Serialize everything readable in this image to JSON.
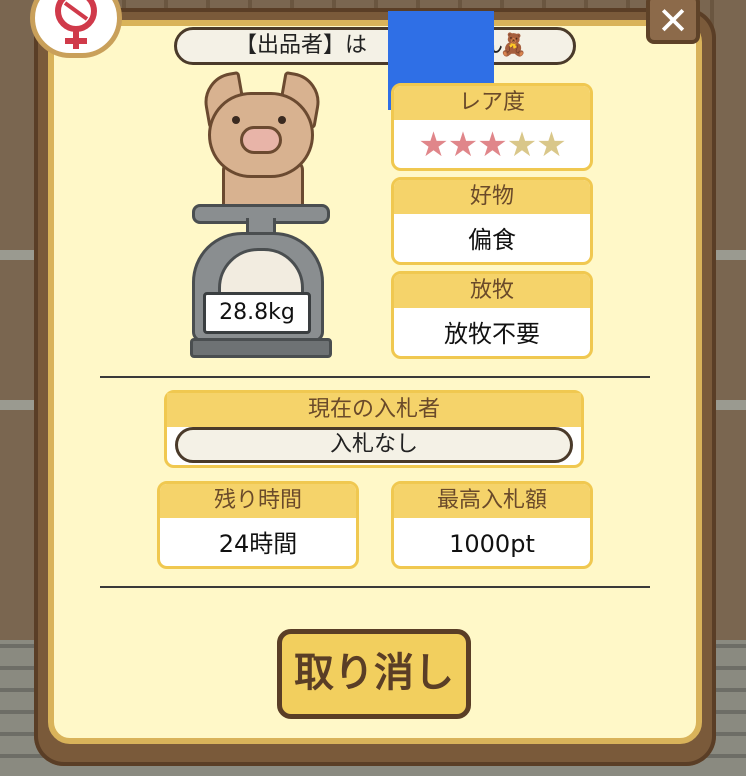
{
  "seller": {
    "label": "【出品者】は",
    "suffix": "ん",
    "bear": "🧸"
  },
  "weight": "28.8kg",
  "rarity": {
    "label": "レア度",
    "stars_filled": 3,
    "stars_total": 5
  },
  "favorite": {
    "label": "好物",
    "value": "偏食"
  },
  "grazing": {
    "label": "放牧",
    "value": "放牧不要"
  },
  "current_bidder": {
    "label": "現在の入札者",
    "value": "入札なし"
  },
  "time_left": {
    "label": "残り時間",
    "value": "24時間"
  },
  "highest_bid": {
    "label": "最高入札額",
    "value": "1000pt"
  },
  "cancel_label": "取り消し",
  "close_icon": "✕",
  "colors": {
    "panel": "#fff8c8",
    "header": "#f5d36a",
    "star_on": "#e0868a",
    "star_off": "#d9c78a",
    "button": "#f2cf5e"
  }
}
